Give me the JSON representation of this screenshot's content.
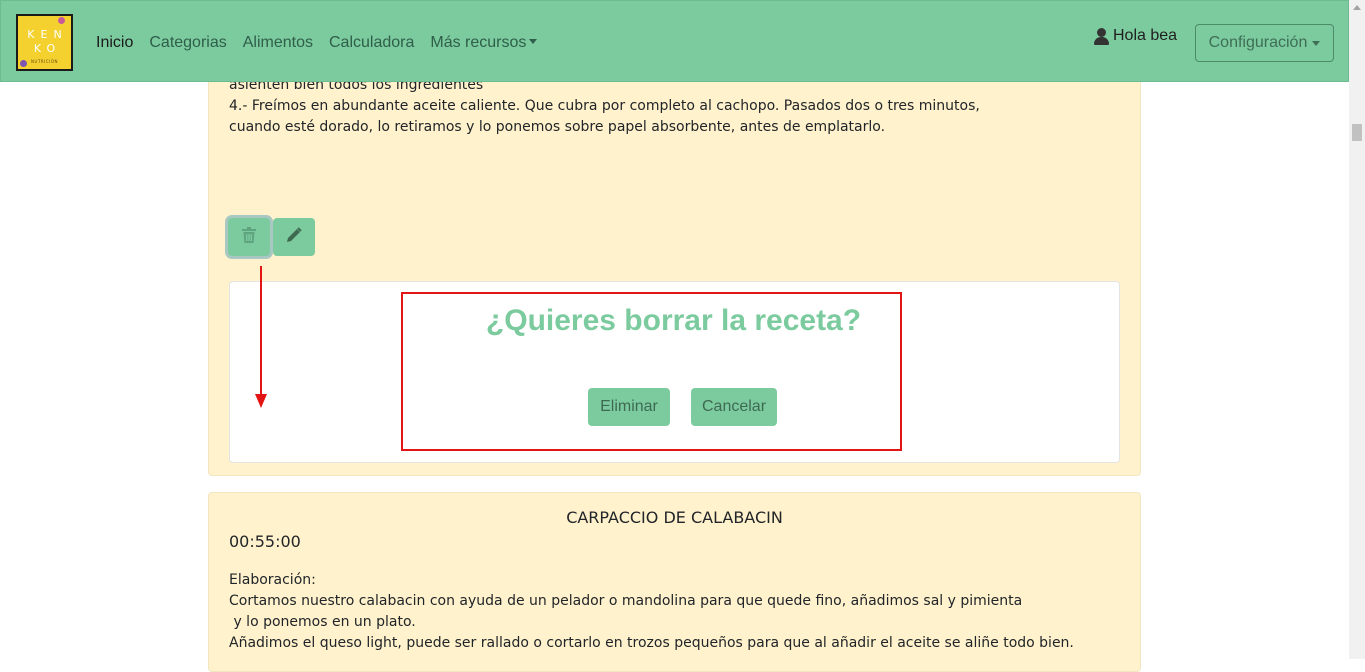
{
  "navbar": {
    "logo_line1": "KEN",
    "logo_line2": "KO",
    "logo_line3": "NUTRICIÓN",
    "links": [
      "Inicio",
      "Categorias",
      "Alimentos",
      "Calculadora",
      "Más recursos"
    ],
    "user_greeting": "Hola bea",
    "config_label": "Configuración"
  },
  "recipe1": {
    "text_lines": [
      "asienten bien todos los ingredientes",
      "4.- Freímos en abundante aceite caliente. Que cubra por completo al cachopo. Pasados dos o tres minutos,",
      "cuando esté dorado, lo retiramos y lo ponemos sobre papel absorbente, antes de emplatarlo."
    ],
    "delete_icon": "trash-icon",
    "edit_icon": "pencil-icon"
  },
  "confirm": {
    "title": "¿Quieres borrar la receta?",
    "delete_label": "Eliminar",
    "cancel_label": "Cancelar"
  },
  "recipe2": {
    "title": "CARPACCIO DE CALABACIN",
    "time": "00:55:00",
    "lines": [
      "Elaboración:",
      "Cortamos nuestro calabacin con ayuda de un pelador o mandolina para que quede fino, añadimos sal y pimienta",
      " y lo ponemos en un plato.",
      "Añadimos el queso light, puede ser rallado o cortarlo en trozos pequeños para que al añadir el aceite se aliñe todo bien."
    ]
  },
  "colors": {
    "navbar": "#7ccb9f",
    "card": "#fff2cc",
    "annotation": "#e31414"
  }
}
